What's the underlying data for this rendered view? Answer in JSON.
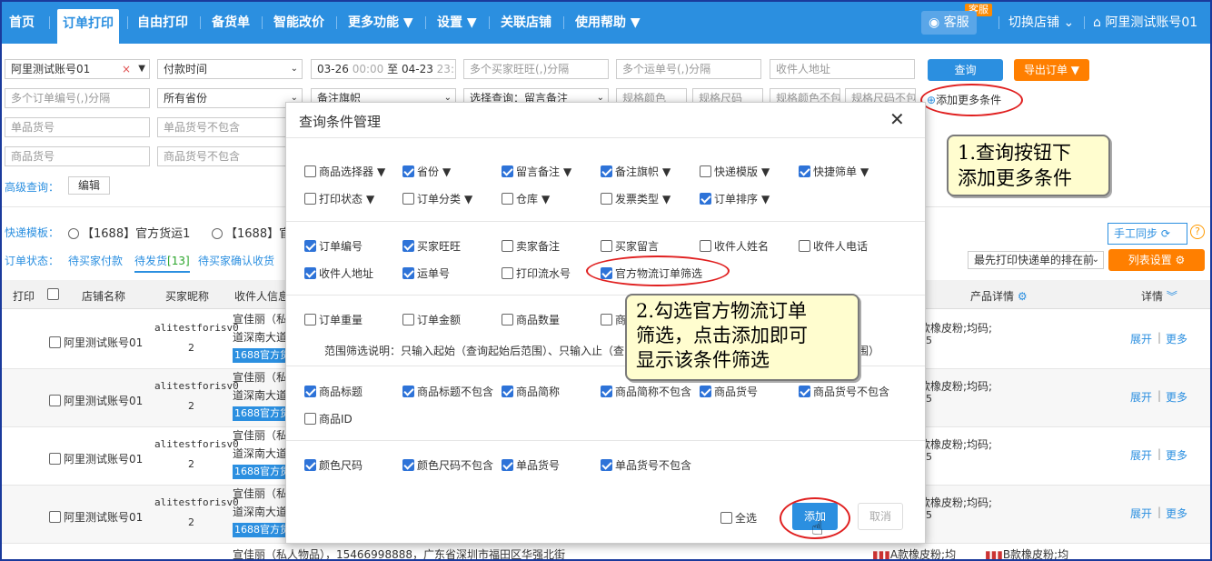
{
  "nav": {
    "home": "首页",
    "order_print": "订单打印",
    "free_print": "自由打印",
    "stock": "备货单",
    "smart_price": "智能改价",
    "more": "更多功能",
    "settings": "设置",
    "linked_shops": "关联店铺",
    "help": "使用帮助",
    "service_badge": "客服",
    "service": "客服",
    "switch_shop": "切换店铺",
    "account": "阿里测试账号01"
  },
  "filters": {
    "shop_value": "阿里测试账号01",
    "pay_time": "付款时间",
    "date_start": "03-26",
    "time_start": "00:00",
    "to": "至",
    "date_end": "04-23",
    "time_end": "23:59",
    "buyer_ww_ph": "多个买家旺旺(,)分隔",
    "waybill_ph": "多个运单号(,)分隔",
    "addr_ph": "收件人地址",
    "search_btn": "查询",
    "export_btn": "导出订单",
    "order_no_ph": "多个订单编号(,)分隔",
    "province": "所有省份",
    "note_flag": "备注旗帜",
    "choose_query": "选择查询：留言备注",
    "spec_color": "规格颜色",
    "spec_size": "规格尺码",
    "spec_color_ex": "规格颜色不包",
    "spec_size_ex": "规格尺码不包",
    "add_more": "添加更多条件",
    "sku_no_ph": "单品货号",
    "sku_no_ex_ph": "单品货号不包含",
    "goods_no_ph": "商品货号",
    "goods_no_ex_ph": "商品货号不包含",
    "advanced": "高级查询：",
    "edit": "编辑"
  },
  "templates": {
    "label": "快递模板：",
    "t1": "【1688】官方货运1",
    "t2": "【1688】官"
  },
  "status": {
    "label": "订单状态：",
    "s1": "待买家付款",
    "s2": "待发货",
    "s2_count": "[13]",
    "s3": "待买家确认收货"
  },
  "right_tools": {
    "manual_sync": "手工同步",
    "sort_select": "最先打印快递单的排在前",
    "list_settings": "列表设置"
  },
  "table": {
    "headers": {
      "print": "打印",
      "shop": "店铺名称",
      "buyer": "买家昵称",
      "receiver": "收件人信息",
      "product": "产品详情",
      "detail": "详情"
    },
    "rows": [
      {
        "shop": "阿里测试账号01",
        "buyer1": "alitestforisv0",
        "buyer2": "2",
        "recv1": "宣佳丽（私",
        "recv2": "道深南大道",
        "tag": "1688官方货",
        "product1": "款橡皮粉;均码;",
        "product2": "45",
        "expand": "展开",
        "more": "更多"
      },
      {
        "shop": "阿里测试账号01",
        "buyer1": "alitestforisv0",
        "buyer2": "2",
        "recv1": "宣佳丽（私",
        "recv2": "道深南大道",
        "tag": "1688官方货",
        "product1": "款橡皮粉;均码;",
        "product2": "45",
        "expand": "展开",
        "more": "更多"
      },
      {
        "shop": "阿里测试账号01",
        "buyer1": "alitestforisv0",
        "buyer2": "2",
        "recv1": "宣佳丽（私",
        "recv2": "道深南大道",
        "tag": "1688官方货",
        "product1": "款橡皮粉;均码;",
        "product2": "45",
        "expand": "展开",
        "more": "更多"
      },
      {
        "shop": "阿里测试账号01",
        "buyer1": "alitestforisv0",
        "buyer2": "2",
        "recv1": "宣佳丽（私",
        "recv2": "道深南大道",
        "tag": "1688官方货",
        "product1": "款橡皮粉;均码;",
        "product2": "45",
        "expand": "展开",
        "more": "更多"
      }
    ],
    "last_row": "宣佳丽（私人物品），15466998888，广东省深圳市福田区华强北街",
    "last_product_a": "A款橡皮粉;均",
    "last_product_b": "B款橡皮粉;均"
  },
  "modal": {
    "title": "查询条件管理",
    "g1": [
      {
        "label": "商品选择器",
        "on": false
      },
      {
        "label": "省份",
        "on": true
      },
      {
        "label": "留言备注",
        "on": true
      },
      {
        "label": "备注旗帜",
        "on": true
      },
      {
        "label": "快递模版",
        "on": false
      },
      {
        "label": "快捷筛单",
        "on": true
      },
      {
        "label": "打印状态",
        "on": false
      },
      {
        "label": "订单分类",
        "on": false
      },
      {
        "label": "仓库",
        "on": false
      },
      {
        "label": "发票类型",
        "on": false
      },
      {
        "label": "订单排序",
        "on": true
      }
    ],
    "g2": [
      {
        "label": "订单编号",
        "on": true
      },
      {
        "label": "买家旺旺",
        "on": true
      },
      {
        "label": "卖家备注",
        "on": false
      },
      {
        "label": "买家留言",
        "on": false
      },
      {
        "label": "收件人姓名",
        "on": false
      },
      {
        "label": "收件人电话",
        "on": false
      },
      {
        "label": "收件人地址",
        "on": true
      },
      {
        "label": "运单号",
        "on": true
      },
      {
        "label": "打印流水号",
        "on": false
      },
      {
        "label": "官方物流订单筛选",
        "on": true
      }
    ],
    "g3": [
      {
        "label": "订单重量",
        "on": false
      },
      {
        "label": "订单金额",
        "on": false
      },
      {
        "label": "商品数量",
        "on": false
      },
      {
        "label": "商",
        "on": false
      }
    ],
    "range_note": "范围筛选说明：只输入起始（查询起始后范围）、只输入止（查",
    "range_note_end": "围）",
    "g4": [
      {
        "label": "商品标题",
        "on": true
      },
      {
        "label": "商品标题不包含",
        "on": true
      },
      {
        "label": "商品简称",
        "on": true
      },
      {
        "label": "商品简称不包含",
        "on": true
      },
      {
        "label": "商品货号",
        "on": true
      },
      {
        "label": "商品货号不包含",
        "on": true
      },
      {
        "label": "商品ID",
        "on": false
      }
    ],
    "g5": [
      {
        "label": "颜色尺码",
        "on": true
      },
      {
        "label": "颜色尺码不包含",
        "on": true
      },
      {
        "label": "单品货号",
        "on": true
      },
      {
        "label": "单品货号不包含",
        "on": true
      }
    ],
    "select_all": "全选",
    "add": "添加",
    "cancel": "取消"
  },
  "callouts": {
    "c1_line1": "1.查询按钮下",
    "c1_line2": "添加更多条件",
    "c2_line1": "2.勾选官方物流订单",
    "c2_line2": "筛选，点击添加即可",
    "c2_line3": "显示该条件筛选"
  },
  "colors": {
    "nav": "#2b8fe0",
    "orange": "#ff7f00",
    "highlight": "#e02020"
  }
}
